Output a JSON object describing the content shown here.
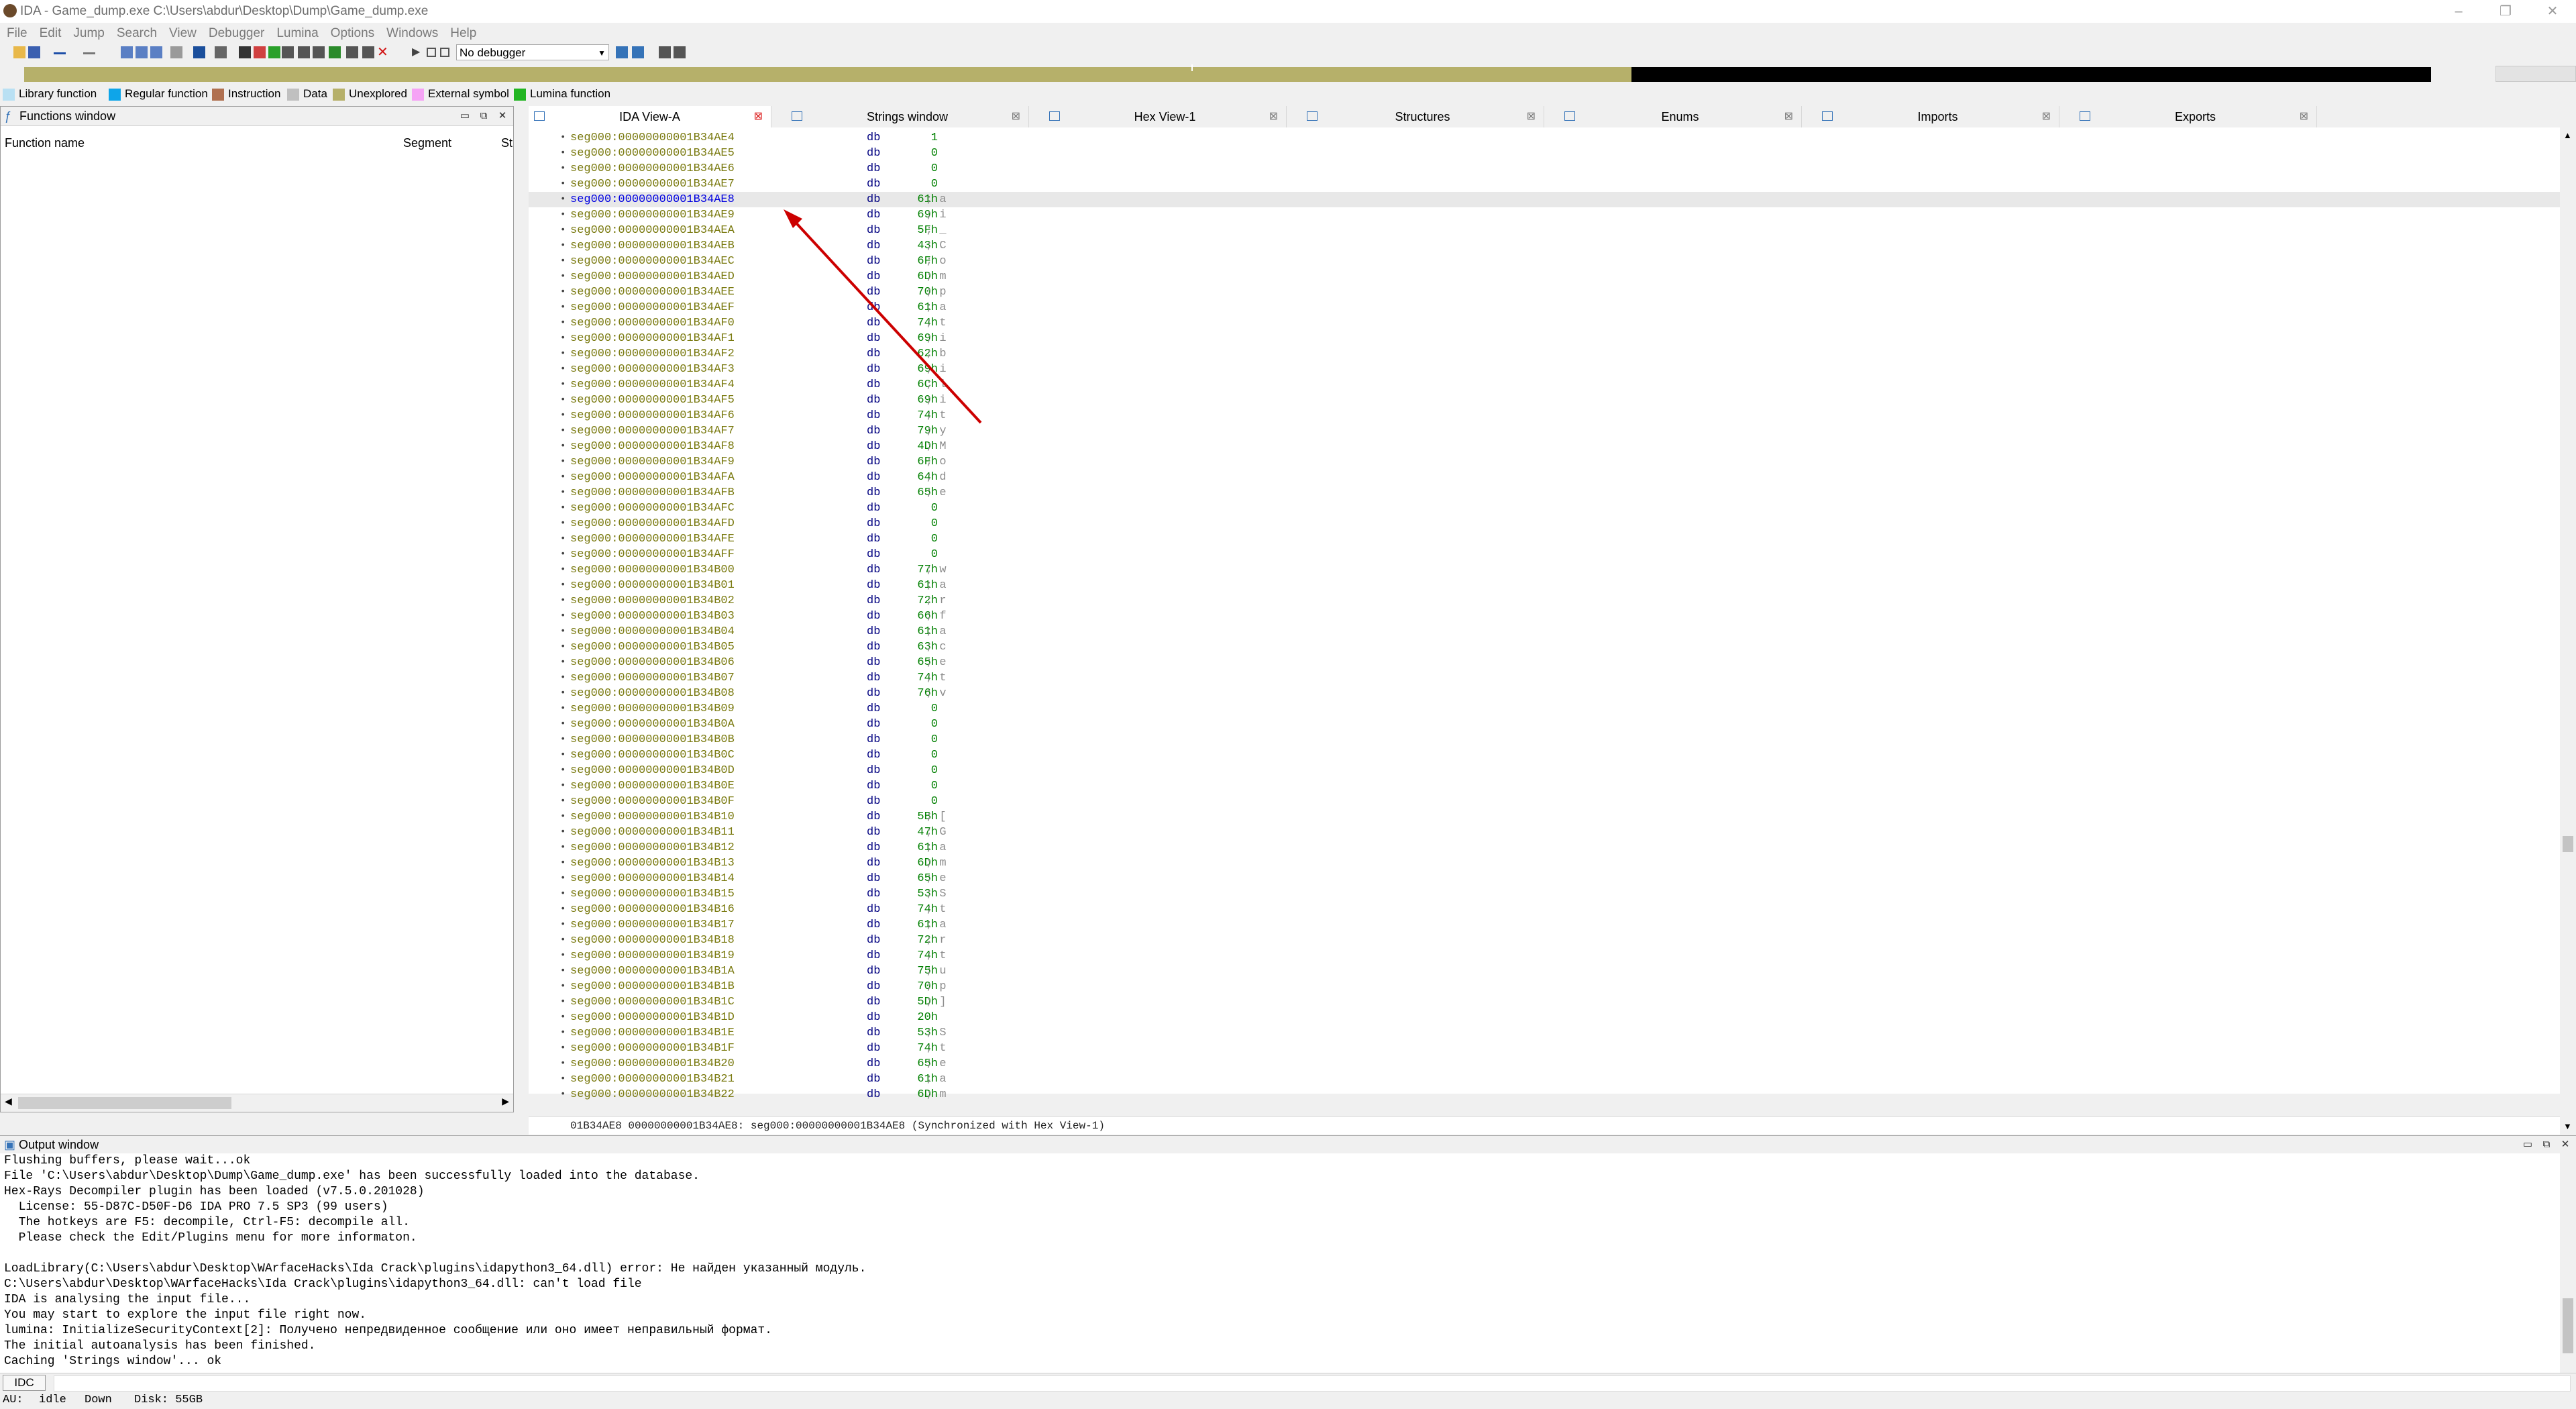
{
  "window": {
    "title": "IDA - Game_dump.exe C:\\Users\\abdur\\Desktop\\Dump\\Game_dump.exe",
    "controls": [
      "–",
      "❐",
      "✕"
    ]
  },
  "menu": [
    "File",
    "Edit",
    "Jump",
    "Search",
    "View",
    "Debugger",
    "Lumina",
    "Options",
    "Windows",
    "Help"
  ],
  "toolbar": {
    "debugger_select": "No debugger"
  },
  "legend": [
    {
      "label": "Library function",
      "color": "#b9e0f3"
    },
    {
      "label": "Regular function",
      "color": "#0ea5e9"
    },
    {
      "label": "Instruction",
      "color": "#b07050"
    },
    {
      "label": "Data",
      "color": "#c0c0c0"
    },
    {
      "label": "Unexplored",
      "color": "#b6b06a"
    },
    {
      "label": "External symbol",
      "color": "#f5a3f5"
    },
    {
      "label": "Lumina function",
      "color": "#22b522"
    }
  ],
  "functions_window": {
    "title": "Functions window",
    "columns": [
      "Function name",
      "Segment",
      "St"
    ]
  },
  "tabs": [
    {
      "label": "IDA View-A",
      "active": true
    },
    {
      "label": "Strings window",
      "active": false
    },
    {
      "label": "Hex View-1",
      "active": false
    },
    {
      "label": "Structures",
      "active": false
    },
    {
      "label": "Enums",
      "active": false
    },
    {
      "label": "Imports",
      "active": false
    },
    {
      "label": "Exports",
      "active": false
    }
  ],
  "listing": {
    "mnemonic": "db",
    "rows": [
      {
        "addr": "seg000:00000000001B34AE4",
        "val": "1",
        "cmt": ""
      },
      {
        "addr": "seg000:00000000001B34AE5",
        "val": "0",
        "cmt": ""
      },
      {
        "addr": "seg000:00000000001B34AE6",
        "val": "0",
        "cmt": ""
      },
      {
        "addr": "seg000:00000000001B34AE7",
        "val": "0",
        "cmt": ""
      },
      {
        "addr": "seg000:00000000001B34AE8",
        "val": "61h",
        "cmt": "; a",
        "selected": true
      },
      {
        "addr": "seg000:00000000001B34AE9",
        "val": "69h",
        "cmt": "; i"
      },
      {
        "addr": "seg000:00000000001B34AEA",
        "val": "5Fh",
        "cmt": "; _"
      },
      {
        "addr": "seg000:00000000001B34AEB",
        "val": "43h",
        "cmt": "; C"
      },
      {
        "addr": "seg000:00000000001B34AEC",
        "val": "6Fh",
        "cmt": "; o"
      },
      {
        "addr": "seg000:00000000001B34AED",
        "val": "6Dh",
        "cmt": "; m"
      },
      {
        "addr": "seg000:00000000001B34AEE",
        "val": "70h",
        "cmt": "; p"
      },
      {
        "addr": "seg000:00000000001B34AEF",
        "val": "61h",
        "cmt": "; a"
      },
      {
        "addr": "seg000:00000000001B34AF0",
        "val": "74h",
        "cmt": "; t"
      },
      {
        "addr": "seg000:00000000001B34AF1",
        "val": "69h",
        "cmt": "; i"
      },
      {
        "addr": "seg000:00000000001B34AF2",
        "val": "62h",
        "cmt": "; b"
      },
      {
        "addr": "seg000:00000000001B34AF3",
        "val": "69h",
        "cmt": "; i"
      },
      {
        "addr": "seg000:00000000001B34AF4",
        "val": "6Ch",
        "cmt": "; l"
      },
      {
        "addr": "seg000:00000000001B34AF5",
        "val": "69h",
        "cmt": "; i"
      },
      {
        "addr": "seg000:00000000001B34AF6",
        "val": "74h",
        "cmt": "; t"
      },
      {
        "addr": "seg000:00000000001B34AF7",
        "val": "79h",
        "cmt": "; y"
      },
      {
        "addr": "seg000:00000000001B34AF8",
        "val": "4Dh",
        "cmt": "; M"
      },
      {
        "addr": "seg000:00000000001B34AF9",
        "val": "6Fh",
        "cmt": "; o"
      },
      {
        "addr": "seg000:00000000001B34AFA",
        "val": "64h",
        "cmt": "; d"
      },
      {
        "addr": "seg000:00000000001B34AFB",
        "val": "65h",
        "cmt": "; e"
      },
      {
        "addr": "seg000:00000000001B34AFC",
        "val": "0",
        "cmt": ""
      },
      {
        "addr": "seg000:00000000001B34AFD",
        "val": "0",
        "cmt": ""
      },
      {
        "addr": "seg000:00000000001B34AFE",
        "val": "0",
        "cmt": ""
      },
      {
        "addr": "seg000:00000000001B34AFF",
        "val": "0",
        "cmt": ""
      },
      {
        "addr": "seg000:00000000001B34B00",
        "val": "77h",
        "cmt": "; w"
      },
      {
        "addr": "seg000:00000000001B34B01",
        "val": "61h",
        "cmt": "; a"
      },
      {
        "addr": "seg000:00000000001B34B02",
        "val": "72h",
        "cmt": "; r"
      },
      {
        "addr": "seg000:00000000001B34B03",
        "val": "66h",
        "cmt": "; f"
      },
      {
        "addr": "seg000:00000000001B34B04",
        "val": "61h",
        "cmt": "; a"
      },
      {
        "addr": "seg000:00000000001B34B05",
        "val": "63h",
        "cmt": "; c"
      },
      {
        "addr": "seg000:00000000001B34B06",
        "val": "65h",
        "cmt": "; e"
      },
      {
        "addr": "seg000:00000000001B34B07",
        "val": "74h",
        "cmt": "; t"
      },
      {
        "addr": "seg000:00000000001B34B08",
        "val": "76h",
        "cmt": "; v"
      },
      {
        "addr": "seg000:00000000001B34B09",
        "val": "0",
        "cmt": ""
      },
      {
        "addr": "seg000:00000000001B34B0A",
        "val": "0",
        "cmt": ""
      },
      {
        "addr": "seg000:00000000001B34B0B",
        "val": "0",
        "cmt": ""
      },
      {
        "addr": "seg000:00000000001B34B0C",
        "val": "0",
        "cmt": ""
      },
      {
        "addr": "seg000:00000000001B34B0D",
        "val": "0",
        "cmt": ""
      },
      {
        "addr": "seg000:00000000001B34B0E",
        "val": "0",
        "cmt": ""
      },
      {
        "addr": "seg000:00000000001B34B0F",
        "val": "0",
        "cmt": ""
      },
      {
        "addr": "seg000:00000000001B34B10",
        "val": "5Bh",
        "cmt": "; ["
      },
      {
        "addr": "seg000:00000000001B34B11",
        "val": "47h",
        "cmt": "; G"
      },
      {
        "addr": "seg000:00000000001B34B12",
        "val": "61h",
        "cmt": "; a"
      },
      {
        "addr": "seg000:00000000001B34B13",
        "val": "6Dh",
        "cmt": "; m"
      },
      {
        "addr": "seg000:00000000001B34B14",
        "val": "65h",
        "cmt": "; e"
      },
      {
        "addr": "seg000:00000000001B34B15",
        "val": "53h",
        "cmt": "; S"
      },
      {
        "addr": "seg000:00000000001B34B16",
        "val": "74h",
        "cmt": "; t"
      },
      {
        "addr": "seg000:00000000001B34B17",
        "val": "61h",
        "cmt": "; a"
      },
      {
        "addr": "seg000:00000000001B34B18",
        "val": "72h",
        "cmt": "; r"
      },
      {
        "addr": "seg000:00000000001B34B19",
        "val": "74h",
        "cmt": "; t"
      },
      {
        "addr": "seg000:00000000001B34B1A",
        "val": "75h",
        "cmt": "; u"
      },
      {
        "addr": "seg000:00000000001B34B1B",
        "val": "70h",
        "cmt": "; p"
      },
      {
        "addr": "seg000:00000000001B34B1C",
        "val": "5Dh",
        "cmt": "; ]"
      },
      {
        "addr": "seg000:00000000001B34B1D",
        "val": "20h",
        "cmt": ""
      },
      {
        "addr": "seg000:00000000001B34B1E",
        "val": "53h",
        "cmt": "; S"
      },
      {
        "addr": "seg000:00000000001B34B1F",
        "val": "74h",
        "cmt": "; t"
      },
      {
        "addr": "seg000:00000000001B34B20",
        "val": "65h",
        "cmt": "; e"
      },
      {
        "addr": "seg000:00000000001B34B21",
        "val": "61h",
        "cmt": "; a"
      },
      {
        "addr": "seg000:00000000001B34B22",
        "val": "6Dh",
        "cmt": "; m"
      }
    ],
    "status_line": "01B34AE8 00000000001B34AE8: seg000:00000000001B34AE8 (Synchronized with Hex View-1)"
  },
  "output_window": {
    "title": "Output window",
    "lines": [
      "Flushing buffers, please wait...ok",
      "File 'C:\\Users\\abdur\\Desktop\\Dump\\Game_dump.exe' has been successfully loaded into the database.",
      "Hex-Rays Decompiler plugin has been loaded (v7.5.0.201028)",
      "  License: 55-D87C-D50F-D6 IDA PRO 7.5 SP3 (99 users)",
      "  The hotkeys are F5: decompile, Ctrl-F5: decompile all.",
      "  Please check the Edit/Plugins menu for more informaton.",
      "",
      "LoadLibrary(C:\\Users\\abdur\\Desktop\\WArfaceHacks\\Ida Crack\\plugins\\idapython3_64.dll) error: Не найден указанный модуль.",
      "C:\\Users\\abdur\\Desktop\\WArfaceHacks\\Ida Crack\\plugins\\idapython3_64.dll: can't load file",
      "IDA is analysing the input file...",
      "You may start to explore the input file right now.",
      "lumina: InitializeSecurityContext[2]: Получено непредвиденное сообщение или оно имеет неправильный формат.",
      "The initial autoanalysis has been finished.",
      "Caching 'Strings window'... ok"
    ]
  },
  "command_line": {
    "button": "IDC"
  },
  "status_bar": {
    "au": "AU:",
    "state": "idle",
    "direction": "Down",
    "disk": "Disk: 55GB"
  },
  "annotation": {
    "color": "#cc0000"
  }
}
